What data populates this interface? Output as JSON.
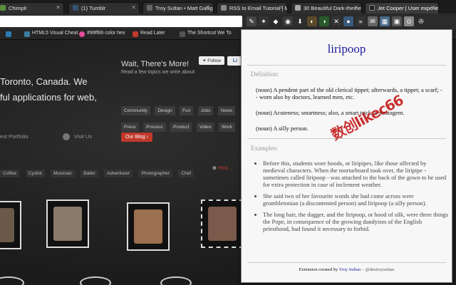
{
  "tabs": [
    {
      "title": "Chimplr",
      "icon_color": "#5a8f3a"
    },
    {
      "title": "(1) Tumblr",
      "icon_color": "#34526f"
    },
    {
      "title": "Troy Sultan • Matt Galligan",
      "icon_color": "#666666"
    },
    {
      "title": "RSS to Email Tutorial | Mail",
      "icon_color": "#888888"
    },
    {
      "title": "30 Beautiful Dark-themed",
      "icon_color": "#aaaaaa"
    },
    {
      "title": "Jet Cooper | User experience",
      "icon_color": "#222222"
    }
  ],
  "bookmarks": [
    {
      "label": "",
      "icon_color": "#2c7bb6"
    },
    {
      "label": "HTML5 Visual Cheat",
      "icon_color": "#3b7ea1"
    },
    {
      "label": "#99ff66 color hex",
      "icon_color": "#e34c9a"
    },
    {
      "label": "Read Later",
      "icon_color": "#c0392b"
    },
    {
      "label": "The Shortcut We To",
      "icon_color": "#555555"
    }
  ],
  "page": {
    "hero_line1": "Toronto, Canada. We",
    "hero_line2": "ful applications for web,",
    "link_portfolio": "est Portfolio",
    "link_visit": "Visit Us",
    "wait_title": "Wait, There's More!",
    "wait_subtitle": "Read a few topics we write about:",
    "topics": [
      "Community",
      "Design",
      "Fun",
      "Jobs",
      "News",
      "Press",
      "Process",
      "Product",
      "Video",
      "Work"
    ],
    "blog_button": "Our Blog",
    "follow_button": "Follow",
    "like_button": "Li",
    "tags": [
      "Coffee",
      "Cyclist",
      "Musician",
      "Baller",
      "Adventurer",
      "Photographer",
      "Chef"
    ],
    "more_link": "Post..."
  },
  "popup": {
    "word": "liripoop",
    "definition_label": "Definition:",
    "definitions": [
      "(noun) A pendent part of the old clerical tippet; afterwards, a tippet; a scarf; -- worn also by doctors, learned men, etc.",
      "(noun) Acuteness; smartness; also, a smart trick or stratagem.",
      "(noun) A silly person."
    ],
    "examples_label": "Examples:",
    "examples": [
      "Before this, students wore hoods, or liripipes, like those affected by medieval characters. When the mortarboard took over, the liripipe - sometimes called liripoop - was attached to the back of the gown to be used for extra protection in case of inclement weather.",
      "She said two of her favourite words she had come across were grumbletonian (a discontented person) and liripoop (a silly person).",
      "The long hair, the dagger, and the liripoop, or hood of silk, were three things the Pope, in consequence of the growing dandyism of the English priesthood, had found it necessary to forbid."
    ],
    "credit_prefix": "Extension created by",
    "credit_author": "Troy Sultan",
    "credit_handle": "@destroysultan",
    "watermark": "数创likec66"
  },
  "colors": {
    "popup_word": "#1a1a9a",
    "accent_red": "#c0392b"
  }
}
